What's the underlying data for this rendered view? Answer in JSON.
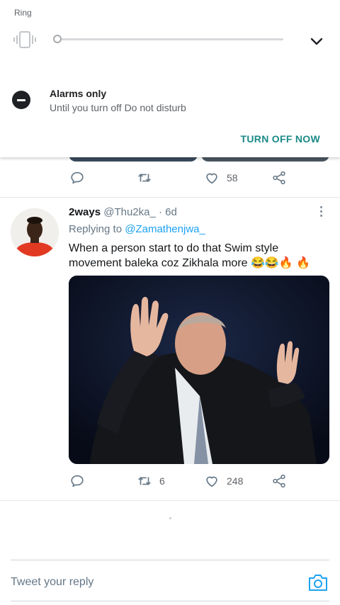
{
  "volume_panel": {
    "stream_label": "Ring",
    "ringer_mode_icon": "vibrate-icon",
    "volume_level": 0.0,
    "expand_icon": "chevron-down-icon"
  },
  "dnd": {
    "icon": "do-not-disturb-icon",
    "title": "Alarms only",
    "subtitle": "Until you turn off Do not disturb",
    "action_label": "TURN OFF NOW",
    "action_color": "#1a8a87"
  },
  "previous_tweet": {
    "actions": {
      "reply_count": "",
      "retweet_count": "",
      "like_count": "58"
    }
  },
  "tweet": {
    "display_name": "2ways",
    "handle": "@Thu2ka_",
    "separator": "·",
    "age": "6d",
    "replying_prefix": "Replying to",
    "replying_to": "@Zamathenjwa_",
    "text": "When a person start to do that Swim style movement baleka coz Zikhala more 😂😂🔥 🔥",
    "actions": {
      "reply_count": "",
      "retweet_count": "6",
      "like_count": "248"
    }
  },
  "reply_bar": {
    "placeholder": "Tweet your reply",
    "camera_icon": "camera-icon",
    "accent_color": "#1da1f2"
  }
}
